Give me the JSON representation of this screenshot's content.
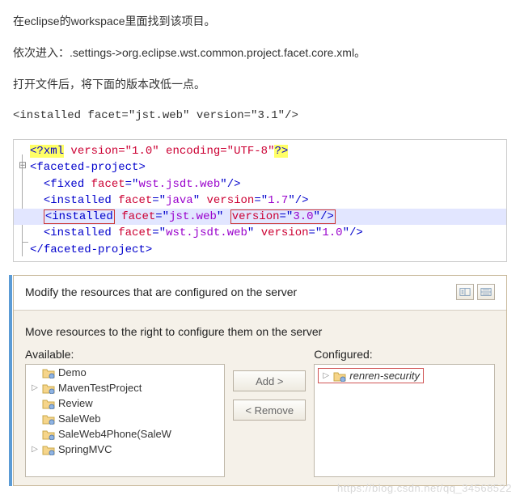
{
  "paragraphs": {
    "p1": "在eclipse的workspace里面找到该项目。",
    "p2": "依次进入：.settings->org.eclipse.wst.common.project.facet.core.xml。",
    "p3": "打开文件后，将下面的版本改低一点。",
    "p4": "<installed facet=\"jst.web\" version=\"3.1\"/>"
  },
  "xml": {
    "decl_open": "<?",
    "decl_xml": "xml",
    "decl_attrs": " version=\"1.0\" encoding=\"UTF-8\"",
    "decl_close": "?>",
    "root_open_lt": "<",
    "root_open_name": "faceted-project",
    "root_open_gt": ">",
    "fixed_tag": "fixed",
    "installed_tag": "installed",
    "facet_attr": "facet",
    "version_attr": "version",
    "eq_open": "=\"",
    "q_close": "\"",
    "slash_gt": "/>",
    "l1_facet": "wst.jsdt.web",
    "l2_facet": "java",
    "l2_ver": "1.7",
    "l3_facet": "jst.web",
    "l3_ver": "3.0",
    "l4_facet": "wst.jsdt.web",
    "l4_ver": "1.0",
    "root_close_lt": "</",
    "root_close_name": "faceted-project",
    "root_close_gt": ">",
    "fold_symbol": "⊟"
  },
  "dialog": {
    "title": "Modify the resources that are configured on the server",
    "move_text": "Move resources to the right to configure them on the server",
    "available_label": "Available:",
    "configured_label": "Configured:",
    "add_btn": "Add >",
    "remove_btn": "< Remove",
    "available_items": [
      {
        "expander": "",
        "label": "Demo"
      },
      {
        "expander": "▷",
        "label": "MavenTestProject"
      },
      {
        "expander": "",
        "label": "Review"
      },
      {
        "expander": "",
        "label": "SaleWeb"
      },
      {
        "expander": "",
        "label": "SaleWeb4Phone(SaleW"
      },
      {
        "expander": "▷",
        "label": "SpringMVC"
      }
    ],
    "configured_item": {
      "expander": "▷",
      "label": "renren-security"
    }
  },
  "watermark": "https://blog.csdn.net/qq_34568522"
}
